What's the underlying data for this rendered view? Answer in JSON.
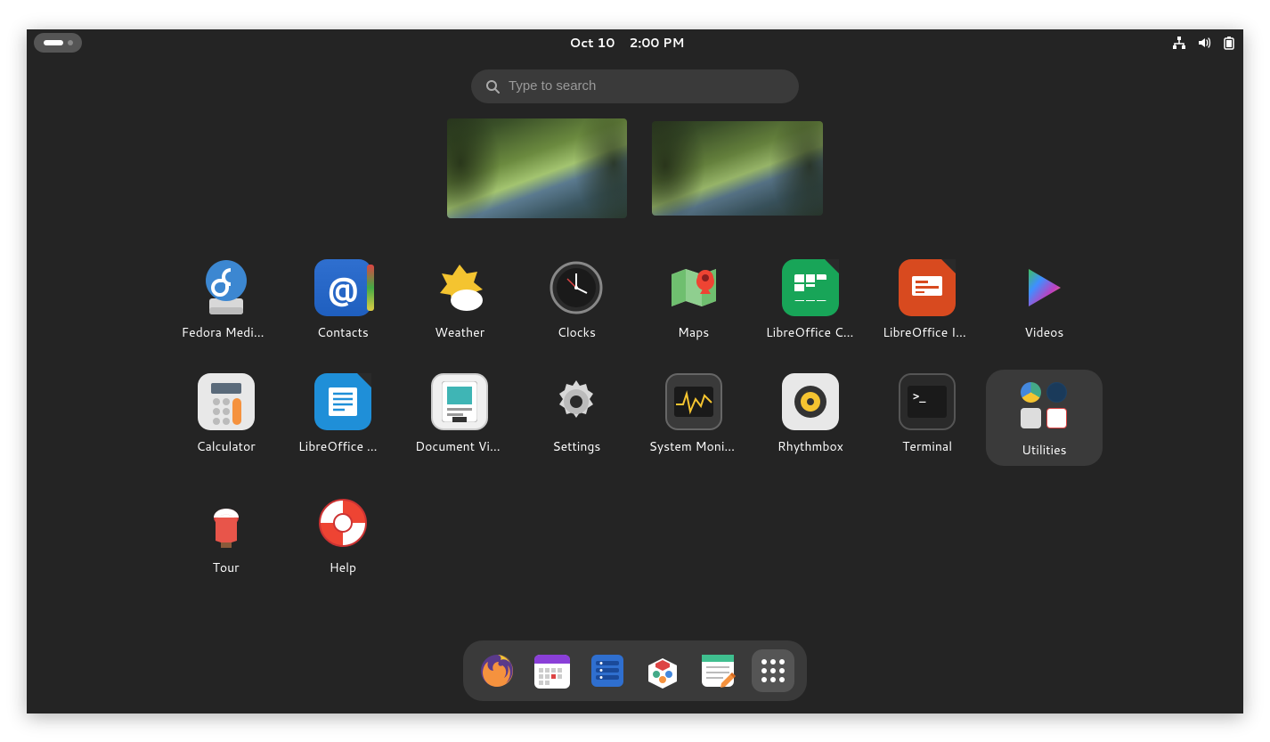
{
  "topbar": {
    "date": "Oct 10",
    "time": "2:00 PM"
  },
  "search": {
    "placeholder": "Type to search"
  },
  "apps": [
    {
      "label": "Fedora Media Writer"
    },
    {
      "label": "Contacts"
    },
    {
      "label": "Weather"
    },
    {
      "label": "Clocks"
    },
    {
      "label": "Maps"
    },
    {
      "label": "LibreOffice Calc"
    },
    {
      "label": "LibreOffice Impress"
    },
    {
      "label": "Videos"
    },
    {
      "label": "Calculator"
    },
    {
      "label": "LibreOffice Writer"
    },
    {
      "label": "Document Viewer"
    },
    {
      "label": "Settings"
    },
    {
      "label": "System Monitor"
    },
    {
      "label": "Rhythmbox"
    },
    {
      "label": "Terminal"
    },
    {
      "label": "Utilities"
    },
    {
      "label": "Tour"
    },
    {
      "label": "Help"
    }
  ],
  "dock": [
    {
      "name": "Firefox"
    },
    {
      "name": "Calendar"
    },
    {
      "name": "Files"
    },
    {
      "name": "Software"
    },
    {
      "name": "Text Editor"
    },
    {
      "name": "Show Apps"
    }
  ]
}
